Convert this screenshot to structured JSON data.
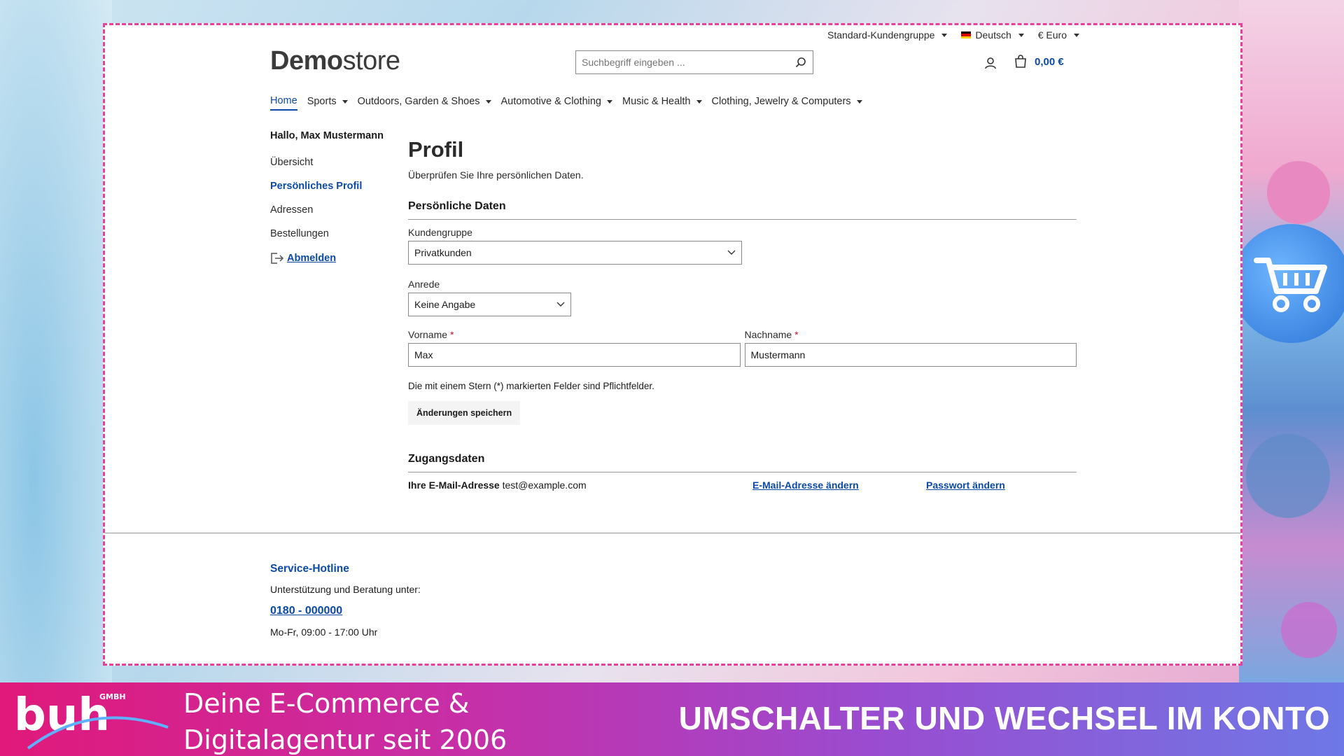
{
  "topbar": {
    "customer_group": "Standard-Kundengruppe",
    "language": "Deutsch",
    "currency": "€ Euro"
  },
  "header": {
    "logo_bold": "Demo",
    "logo_light": "store",
    "search_placeholder": "Suchbegriff eingeben ...",
    "cart_amount": "0,00 €"
  },
  "nav": {
    "items": [
      {
        "label": "Home"
      },
      {
        "label": "Sports"
      },
      {
        "label": "Outdoors, Garden & Shoes"
      },
      {
        "label": "Automotive & Clothing"
      },
      {
        "label": "Music & Health"
      },
      {
        "label": "Clothing, Jewelry & Computers"
      }
    ]
  },
  "sidebar": {
    "greeting": "Hallo, Max Mustermann",
    "items": [
      {
        "label": "Übersicht"
      },
      {
        "label": "Persönliches Profil"
      },
      {
        "label": "Adressen"
      },
      {
        "label": "Bestellungen"
      }
    ],
    "logout": "Abmelden"
  },
  "profile": {
    "title": "Profil",
    "subtitle": "Überprüfen Sie Ihre persönlichen Daten.",
    "section_personal": "Persönliche Daten",
    "customer_group_label": "Kundengruppe",
    "customer_group_value": "Privatkunden",
    "salutation_label": "Anrede",
    "salutation_value": "Keine Angabe",
    "firstname_label": "Vorname",
    "firstname_value": "Max",
    "lastname_label": "Nachname",
    "lastname_value": "Mustermann",
    "required_star": "*",
    "required_hint": "Die mit einem Stern (*) markierten Felder sind Pflichtfelder.",
    "save_label": "Änderungen speichern",
    "section_access": "Zugangsdaten",
    "email_label": "Ihre E-Mail-Adresse",
    "email_value": "test@example.com",
    "change_email": "E-Mail-Adresse ändern",
    "change_password": "Passwort ändern"
  },
  "footer": {
    "title": "Service-Hotline",
    "support": "Unterstützung und Beratung unter:",
    "phone": "0180 - 000000",
    "hours": "Mo-Fr, 09:00 - 17:00 Uhr"
  },
  "banner": {
    "logo_text": "buh",
    "logo_suffix": "GMBH",
    "tagline_1": "Deine E-Commerce &",
    "tagline_2": "Digitalagentur seit 2006",
    "headline": "UMSCHALTER UND WECHSEL IM KONTO"
  },
  "colors": {
    "accent": "#0b4aa7",
    "frame_dash": "#e83e9c",
    "required": "#c8102e"
  }
}
